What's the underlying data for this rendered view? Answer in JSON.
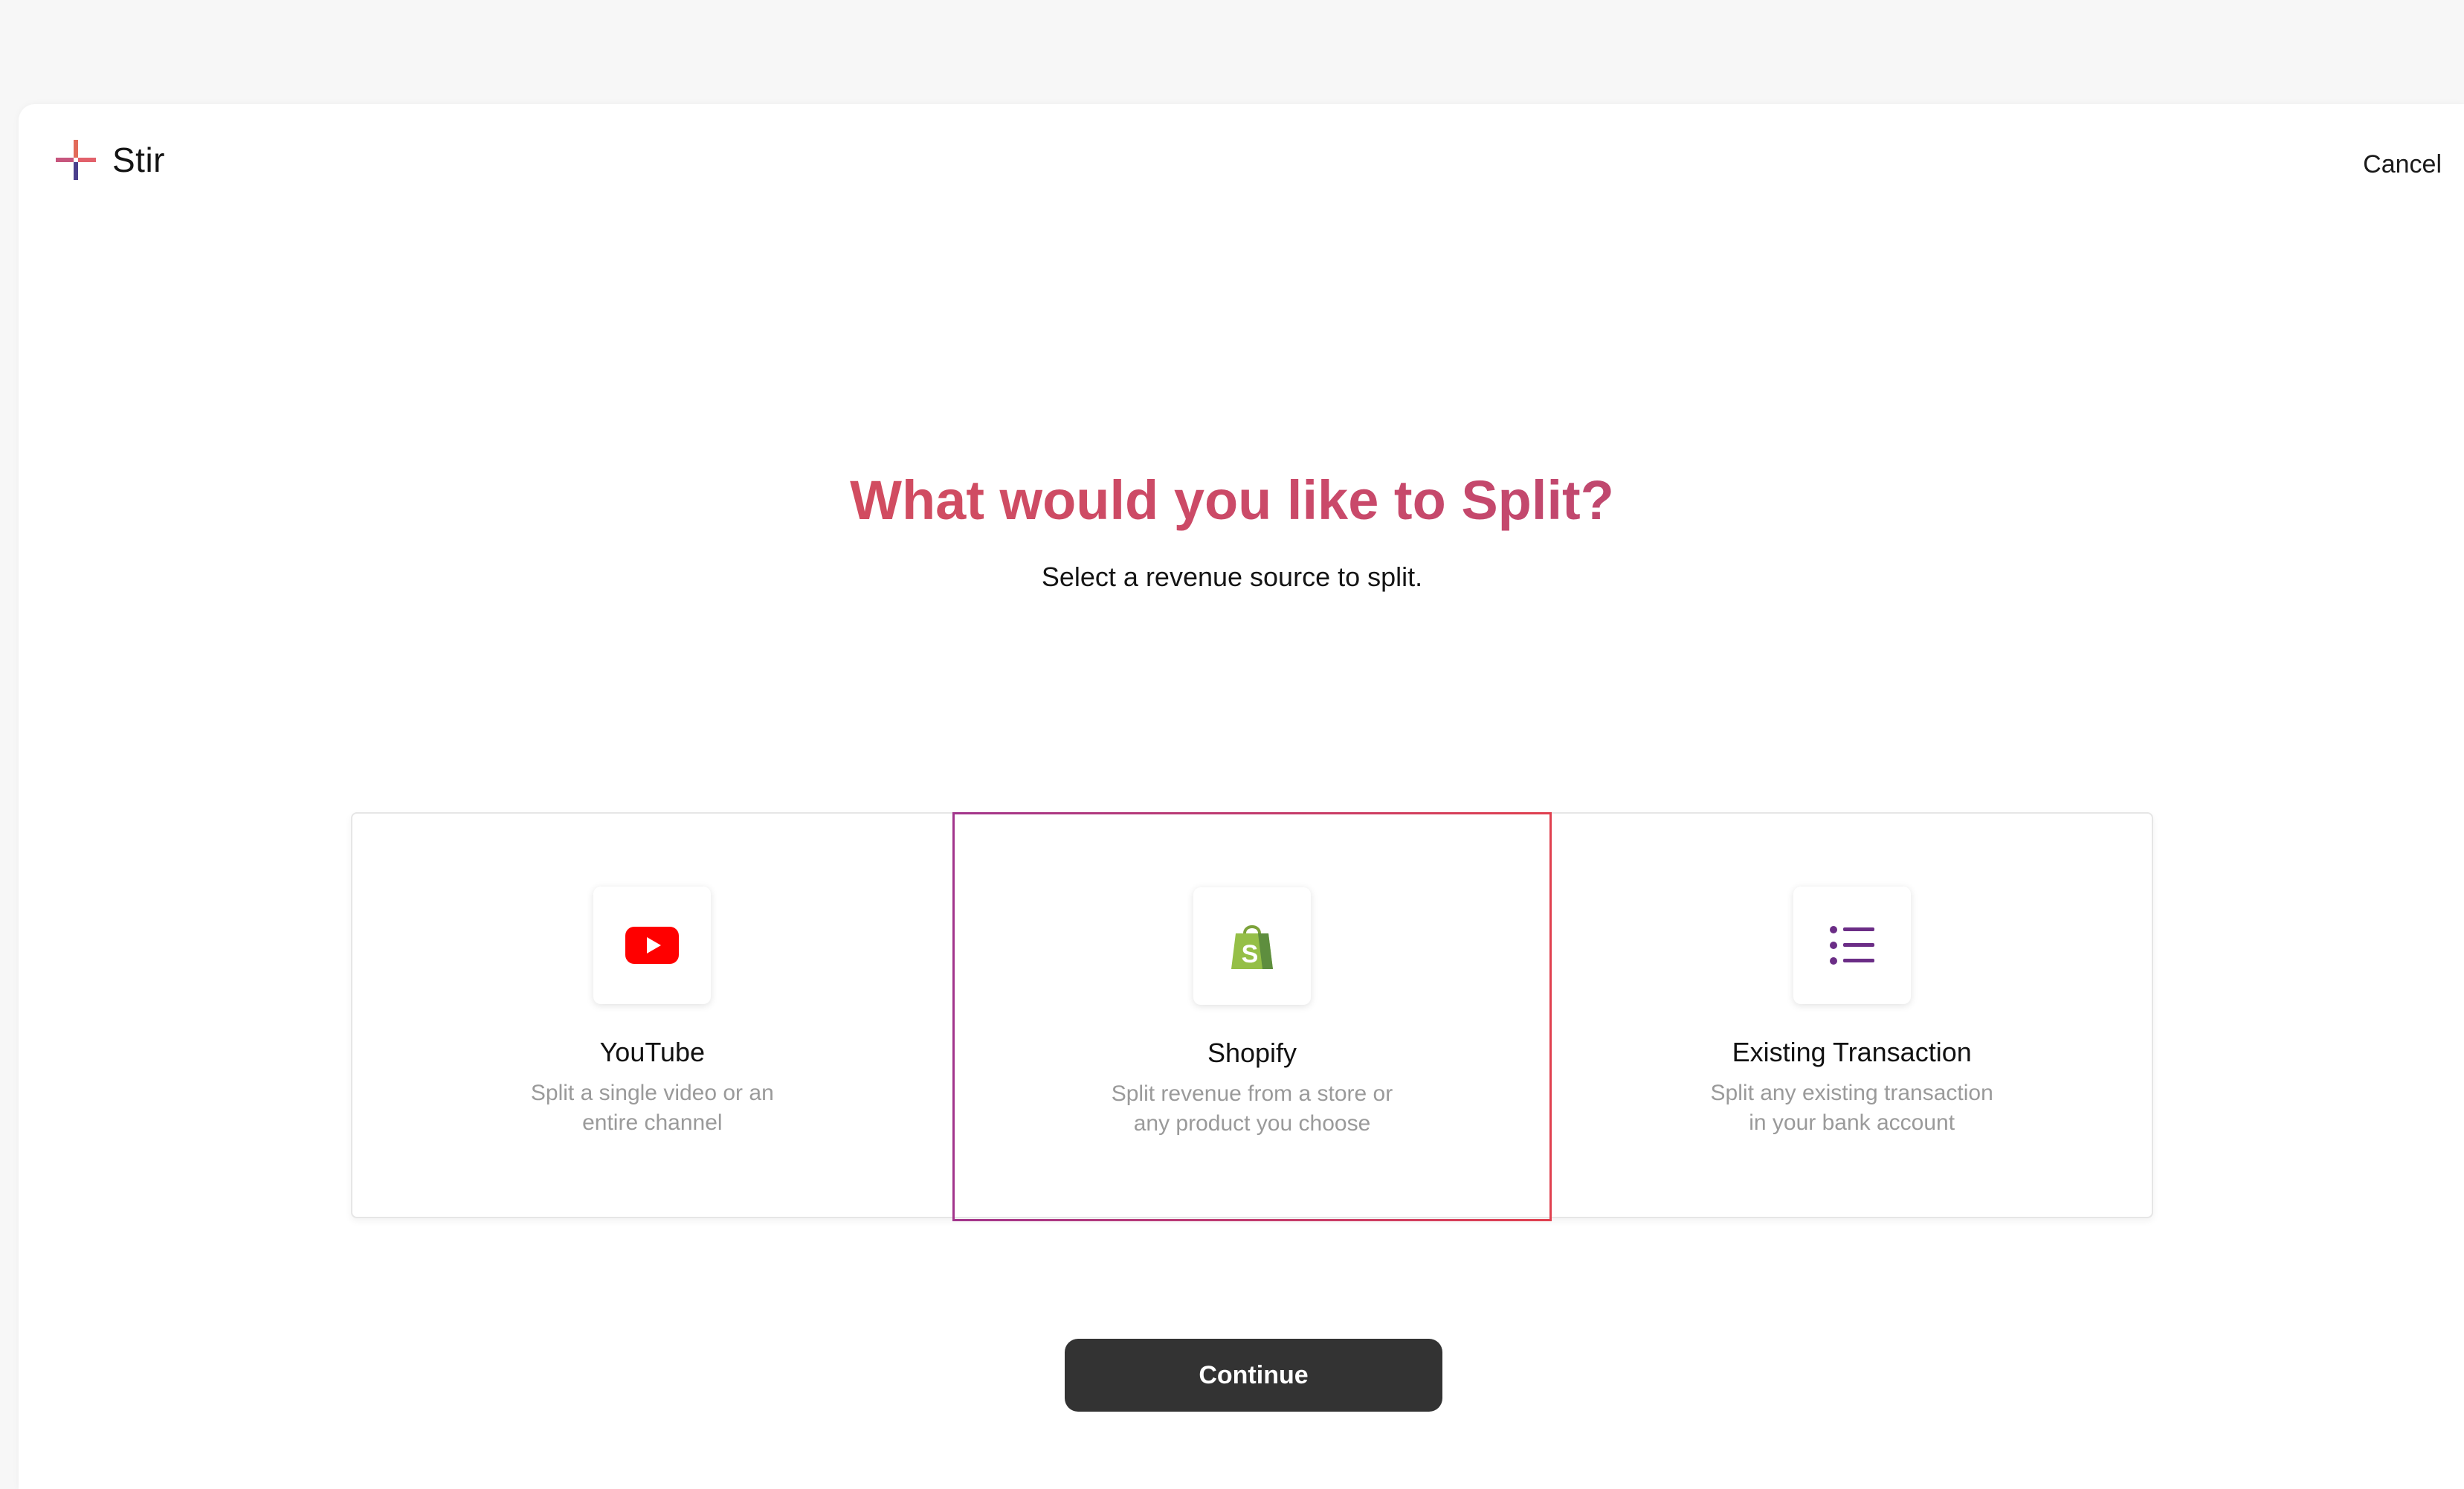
{
  "app": {
    "logo_text": "Stir"
  },
  "header": {
    "cancel_label": "Cancel"
  },
  "main": {
    "title": "What would you like to Split?",
    "subtitle": "Select a revenue source to split.",
    "options": [
      {
        "title": "YouTube",
        "description": "Split a single video or an entire channel",
        "icon": "youtube-icon",
        "selected": false
      },
      {
        "title": "Shopify",
        "description": "Split revenue from a store or any product you choose",
        "icon": "shopify-icon",
        "selected": true
      },
      {
        "title": "Existing Transaction",
        "description": "Split any existing transaction in your bank account",
        "icon": "list-icon",
        "selected": false
      }
    ],
    "continue_label": "Continue"
  },
  "colors": {
    "youtube_red": "#ff0000",
    "shopify_green": "#95bf47",
    "list_purple": "#6b2d86",
    "button_dark": "#333333",
    "title_gradient_start": "#e0524f",
    "title_gradient_end": "#a1447e"
  }
}
